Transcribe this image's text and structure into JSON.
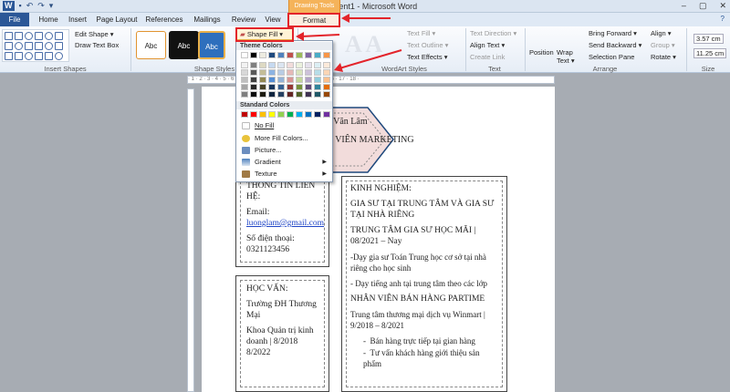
{
  "window": {
    "title": "Document1 - Microsoft Word",
    "context_tab_group": "Drawing Tools",
    "controls": [
      "–",
      "▢",
      "✕"
    ]
  },
  "tabs": [
    "File",
    "Home",
    "Insert",
    "Page Layout",
    "References",
    "Mailings",
    "Review",
    "View",
    "Format"
  ],
  "ribbon": {
    "groups": [
      "Insert Shapes",
      "Shape Styles",
      "WordArt Styles",
      "Text",
      "Arrange",
      "Size"
    ],
    "edit_shape": "Edit Shape ▾",
    "draw_text_box": "Draw Text Box",
    "style_boxes": [
      "Abc",
      "Abc",
      "Abc"
    ],
    "shape_fill": "Shape Fill ▾",
    "text_fill": "Text Fill ▾",
    "text_outline": "Text Outline ▾",
    "text_effects": "Text Effects ▾",
    "text_direction": "Text Direction ▾",
    "align_text": "Align Text ▾",
    "create_link": "Create Link",
    "position": "Position",
    "wrap_text": "Wrap Text ▾",
    "bring_forward": "Bring Forward ▾",
    "send_backward": "Send Backward ▾",
    "selection_pane": "Selection Pane",
    "align": "Align ▾",
    "group": "Group ▾",
    "rotate": "Rotate ▾",
    "height": "3.57 cm",
    "width": "11.25 cm"
  },
  "fill_menu": {
    "theme_header": "Theme Colors",
    "standard_header": "Standard Colors",
    "items": [
      {
        "label": "No Fill"
      },
      {
        "label": "More Fill Colors..."
      },
      {
        "label": "Picture..."
      },
      {
        "label": "Gradient"
      },
      {
        "label": "Texture"
      }
    ],
    "theme_colors": [
      "#ffffff",
      "#000000",
      "#eeece1",
      "#1f497d",
      "#4f81bd",
      "#c0504d",
      "#9bbb59",
      "#8064a2",
      "#4bacc6",
      "#f79646"
    ],
    "theme_shades": [
      [
        "#f2f2f2",
        "#7f7f7f",
        "#ddd9c3",
        "#c6d9f0",
        "#dbe5f1",
        "#f2dcdb",
        "#ebf1dd",
        "#e5e0ec",
        "#dbeef3",
        "#fdeada"
      ],
      [
        "#d8d8d8",
        "#595959",
        "#c4bd97",
        "#8db3e2",
        "#b8cce4",
        "#e5b9b7",
        "#d7e3bc",
        "#ccc1d9",
        "#b7dde8",
        "#fbd5b5"
      ],
      [
        "#bfbfbf",
        "#3f3f3f",
        "#938953",
        "#548dd4",
        "#95b3d7",
        "#d99694",
        "#c3d69b",
        "#b2a2c7",
        "#92cddc",
        "#fac08f"
      ],
      [
        "#a5a5a5",
        "#262626",
        "#494429",
        "#17365d",
        "#366092",
        "#953734",
        "#76923c",
        "#5f497a",
        "#31859b",
        "#e36c09"
      ],
      [
        "#7f7f7f",
        "#0c0c0c",
        "#1d1b10",
        "#0f243e",
        "#244061",
        "#632423",
        "#4f6128",
        "#3f3151",
        "#205867",
        "#974806"
      ]
    ],
    "standard_colors": [
      "#c00000",
      "#ff0000",
      "#ffc000",
      "#ffff00",
      "#92d050",
      "#00b050",
      "#00b0f0",
      "#0070c0",
      "#002060",
      "#7030a0"
    ]
  },
  "document": {
    "header_name": "Lương Văn Lâm",
    "header_title": "NHÂN VIÊN MARKETING",
    "contact": {
      "heading": "THÔNG TIN LIÊN HỆ:",
      "email_label": "Email:",
      "email": "luonglam@gmail.com",
      "phone_label": "Số điện thoại:",
      "phone": "0321123456"
    },
    "education": {
      "heading": "HỌC VẤN:",
      "school": "Trường ĐH Thương Mại",
      "major": "Khoa Quản trị kinh doanh | 8/2018 8/2022"
    },
    "experience": {
      "heading": "KINH NGHIỆM:",
      "job1": "GIA SƯ TẠI TRUNG TÂM VÀ GIA SƯ TẠI NHÀ RIÊNG",
      "job1_place": "TRUNG TÂM GIA SƯ HỌC MÃI | 08/2021 – Nay",
      "job1_desc1": "-Dạy gia sư Toán Trung học cơ sở tại nhà riêng cho học sinh",
      "job1_desc2": "- Dạy tiếng anh tại trung tâm theo các lớp",
      "job2": "NHÂN VIÊN BÁN HÀNG PARTIME",
      "job2_place": "Trung tâm thương mại dịch vụ Winmart | 9/2018 – 8/2021",
      "job2_bullets": [
        "Bán hàng trực tiếp tại gian hàng",
        "Tư vấn khách hàng giới thiệu sản phẩm"
      ]
    }
  }
}
